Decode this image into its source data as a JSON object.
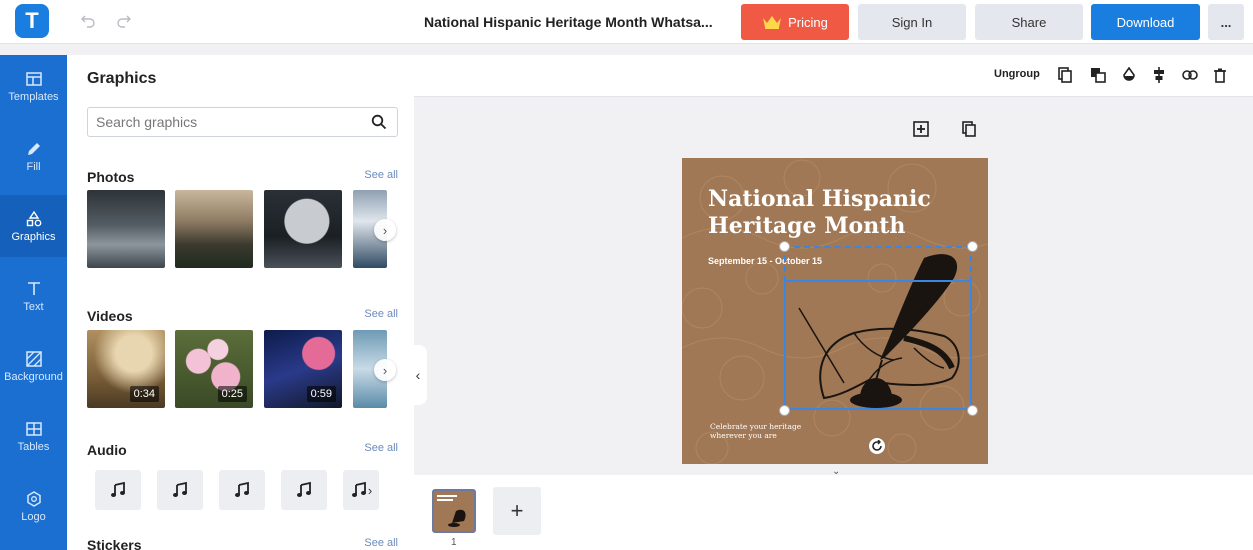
{
  "app": {
    "logo_letter": "T"
  },
  "header": {
    "doc_title": "National Hispanic Heritage Month Whatsa...",
    "pricing_label": "Pricing",
    "signin_label": "Sign In",
    "share_label": "Share",
    "download_label": "Download",
    "more_label": "..."
  },
  "sidebar": {
    "items": [
      {
        "label": "Templates",
        "icon": "templates-icon"
      },
      {
        "label": "Fill",
        "icon": "pencil-icon"
      },
      {
        "label": "Graphics",
        "icon": "shapes-icon",
        "active": true
      },
      {
        "label": "Text",
        "icon": "text-icon"
      },
      {
        "label": "Background",
        "icon": "background-icon"
      },
      {
        "label": "Tables",
        "icon": "table-icon"
      },
      {
        "label": "Logo",
        "icon": "logo-icon"
      }
    ]
  },
  "panel": {
    "title": "Graphics",
    "search_placeholder": "Search graphics",
    "sections": {
      "photos": {
        "title": "Photos",
        "see_all": "See all"
      },
      "videos": {
        "title": "Videos",
        "see_all": "See all",
        "durations": [
          "0:34",
          "0:25",
          "0:59"
        ]
      },
      "audio": {
        "title": "Audio",
        "see_all": "See all"
      },
      "stickers": {
        "title": "Stickers",
        "see_all": "See all"
      }
    }
  },
  "toolbar": {
    "ungroup_label": "Ungroup"
  },
  "design": {
    "title_line1": "National Hispanic",
    "title_line2": "Heritage Month",
    "dates": "September 15 - October 15",
    "footer_line1": "Celebrate your heritage",
    "footer_line2": "wherever you are",
    "background_color": "#a07855"
  },
  "pages": {
    "current_page": "1",
    "add_label": "+"
  },
  "colors": {
    "accent": "#1a7ee0",
    "pricing": "#f05a45",
    "sidebar": "#1a6fd1"
  }
}
